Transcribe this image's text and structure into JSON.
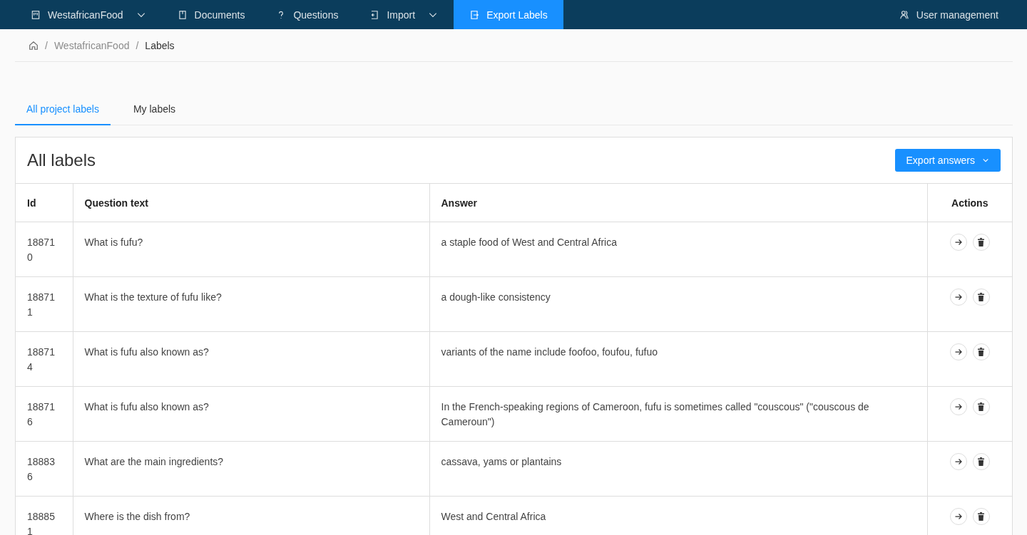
{
  "nav": {
    "items": [
      {
        "label": "WestafricanFood",
        "dropdown": true,
        "selected": false
      },
      {
        "label": "Documents",
        "dropdown": false,
        "selected": false
      },
      {
        "label": "Questions",
        "dropdown": false,
        "selected": false
      },
      {
        "label": "Import",
        "dropdown": true,
        "selected": false
      },
      {
        "label": "Export Labels",
        "dropdown": false,
        "selected": true
      }
    ],
    "user": {
      "label": "User management"
    }
  },
  "breadcrumb": {
    "separator": "/",
    "items": [
      "WestafricanFood",
      "Labels"
    ]
  },
  "tabs": [
    {
      "label": "All project labels",
      "selected": true
    },
    {
      "label": "My labels",
      "selected": false
    }
  ],
  "card": {
    "title": "All labels",
    "export_button": "Export answers"
  },
  "table": {
    "columns": [
      "Id",
      "Question text",
      "Answer",
      "Actions"
    ],
    "rows": [
      {
        "id": "188710",
        "question": "What is fufu?",
        "answer": "a staple food of West and Central Africa"
      },
      {
        "id": "188711",
        "question": "What is the texture of fufu like?",
        "answer": "a dough-like consistency"
      },
      {
        "id": "188714",
        "question": "What is fufu also known as?",
        "answer": "variants of the name include foofoo, foufou, fufuo"
      },
      {
        "id": "188716",
        "question": "What is fufu also known as?",
        "answer": "In the French-speaking regions of Cameroon, fufu is sometimes called \"couscous\" (\"couscous de Cameroun\")"
      },
      {
        "id": "188836",
        "question": "What are the main ingredients?",
        "answer": "cassava, yams or plantains"
      },
      {
        "id": "188851",
        "question": "Where is the dish from?",
        "answer": "West and Central Africa"
      }
    ]
  }
}
